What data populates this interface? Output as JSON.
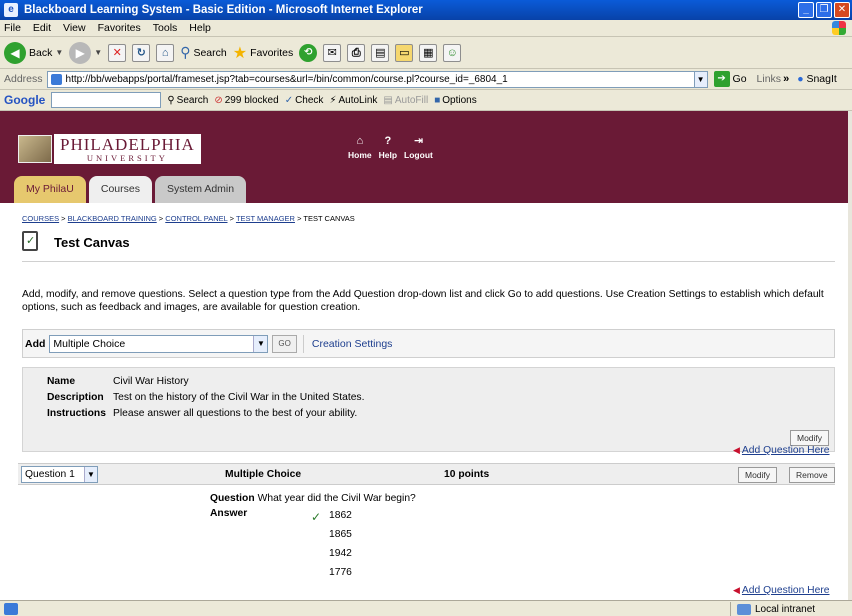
{
  "window": {
    "title": "Blackboard Learning System - Basic Edition - Microsoft Internet Explorer"
  },
  "menu": [
    "File",
    "Edit",
    "View",
    "Favorites",
    "Tools",
    "Help"
  ],
  "toolbar": {
    "back": "Back",
    "search": "Search",
    "favorites": "Favorites"
  },
  "address": {
    "label": "Address",
    "url": "http://bb/webapps/portal/frameset.jsp?tab=courses&url=/bin/common/course.pl?course_id=_6804_1",
    "go": "Go",
    "links": "Links",
    "snagit": "SnagIt"
  },
  "googlebar": {
    "logo": "Google",
    "search": "Search",
    "blocked": "299 blocked",
    "check": "Check",
    "autolink": "AutoLink",
    "autofill": "AutoFill",
    "options": "Options"
  },
  "logo": {
    "line1": "PHILADELPHIA",
    "line2": "UNIVERSITY"
  },
  "topnav": [
    {
      "label": "Home",
      "icon": "home-icon"
    },
    {
      "label": "Help",
      "icon": "help-icon"
    },
    {
      "label": "Logout",
      "icon": "logout-icon"
    }
  ],
  "tabs": [
    "My PhilaU",
    "Courses",
    "System Admin"
  ],
  "breadcrumb": {
    "items": [
      "COURSES",
      "BLACKBOARD TRAINING",
      "CONTROL PANEL",
      "TEST MANAGER"
    ],
    "current": "TEST CANVAS",
    "sep": " > "
  },
  "page": {
    "title": "Test Canvas",
    "description": "Add, modify, and remove questions. Select a question type from the Add Question drop-down list and click Go to add questions. Use Creation Settings to establish which default options, such as feedback and images, are available for question creation."
  },
  "add": {
    "label": "Add",
    "selected": "Multiple Choice",
    "go": "GO",
    "creation": "Creation Settings"
  },
  "test": {
    "rows": [
      {
        "key": "Name",
        "value": "Civil War History"
      },
      {
        "key": "Description",
        "value": "Test on the history of the Civil War in the United States."
      },
      {
        "key": "Instructions",
        "value": "Please answer all questions to the best of your ability."
      }
    ],
    "modify": "Modify"
  },
  "add_question_here": "Add Question Here",
  "question": {
    "select": "Question 1",
    "type": "Multiple Choice",
    "points": "10 points",
    "modify": "Modify",
    "remove": "Remove",
    "label": "Question",
    "text": "What year did the Civil War begin?",
    "answer_label": "Answer",
    "answers": [
      "1862",
      "1865",
      "1942",
      "1776"
    ]
  },
  "status": {
    "zone": "Local intranet"
  }
}
